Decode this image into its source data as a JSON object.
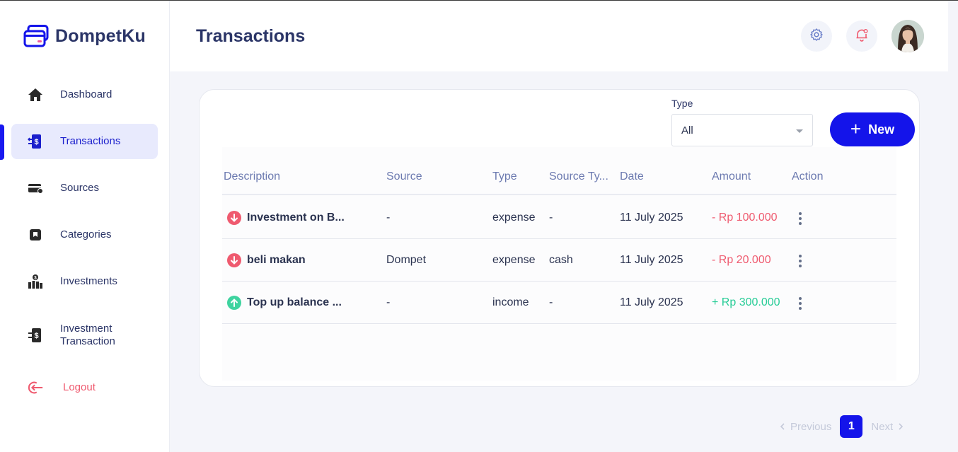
{
  "app": {
    "name": "DompetKu"
  },
  "colors": {
    "primary": "#1414ea",
    "expense": "#ef5a6f",
    "income": "#26cc96",
    "text": "#2b3567"
  },
  "sidebar": {
    "items": [
      {
        "label": "Dashboard",
        "icon": "home-icon"
      },
      {
        "label": "Transactions",
        "icon": "transactions-icon",
        "active": true
      },
      {
        "label": "Sources",
        "icon": "wallet-card-icon"
      },
      {
        "label": "Categories",
        "icon": "category-icon"
      },
      {
        "label": "Investments",
        "icon": "investments-icon"
      },
      {
        "label": "Investment Transaction",
        "icon": "investment-transaction-icon"
      }
    ],
    "logout": {
      "label": "Logout",
      "icon": "logout-icon"
    }
  },
  "header": {
    "title": "Transactions",
    "settings_icon": "gear-icon",
    "notification_icon": "bell-icon"
  },
  "filter": {
    "type_label": "Type",
    "type_value": "All"
  },
  "new_button": {
    "label": "New"
  },
  "table": {
    "headers": [
      "Description",
      "Source",
      "Type",
      "Source Ty...",
      "Date",
      "Amount",
      "Action"
    ],
    "rows": [
      {
        "direction": "expense",
        "description": "Investment on B...",
        "source": "-",
        "type": "expense",
        "source_type": "-",
        "date": "11 July 2025",
        "amount": "- Rp 100.000"
      },
      {
        "direction": "expense",
        "description": "beli makan",
        "source": "Dompet",
        "type": "expense",
        "source_type": "cash",
        "date": "11 July 2025",
        "amount": "- Rp 20.000"
      },
      {
        "direction": "income",
        "description": "Top up balance ...",
        "source": "-",
        "type": "income",
        "source_type": "-",
        "date": "11 July 2025",
        "amount": "+ Rp 300.000"
      }
    ]
  },
  "pagination": {
    "previous": "Previous",
    "current": "1",
    "next": "Next"
  }
}
